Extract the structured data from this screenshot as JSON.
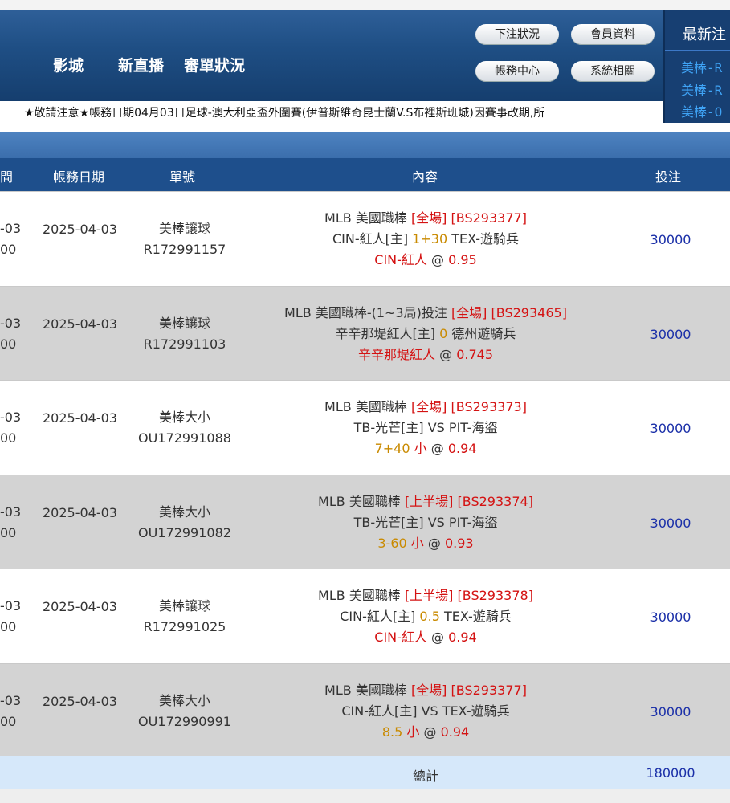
{
  "header": {
    "nav": [
      "影城",
      "新直播",
      "審單狀況"
    ],
    "buttons": [
      "下注狀況",
      "會員資料",
      "帳務中心",
      "系統相關"
    ],
    "news_title": "最新注",
    "news_items": [
      "美棒-R",
      "美棒-R",
      "美棒-O"
    ],
    "marquee": "★敬請注意★帳務日期04月03日足球-澳大利亞盃外圍賽(伊普斯維奇昆士蘭V.S布裡斯班城)因賽事改期,所"
  },
  "table": {
    "columns": [
      "間",
      "帳務日期",
      "單號",
      "內容",
      "投注"
    ],
    "rows": [
      {
        "time": [
          "-03",
          "00"
        ],
        "date": "2025-04-03",
        "ticket_type": "美棒讓球",
        "ticket_no": "R172991157",
        "league": "MLB 美國職棒",
        "period": "[全場]",
        "code": "[BS293377]",
        "home": "CIN-紅人[主]",
        "line": "1+30",
        "away": "TEX-遊騎兵",
        "pick": "CIN-紅人",
        "pick_extra": "",
        "odds": "0.95",
        "amount": "30000"
      },
      {
        "time": [
          "-03",
          "00"
        ],
        "date": "2025-04-03",
        "ticket_type": "美棒讓球",
        "ticket_no": "R172991103",
        "league": "MLB 美國職棒-(1~3局)投注",
        "period": "[全場]",
        "code": "[BS293465]",
        "home": "辛辛那堤紅人[主]",
        "line": "0",
        "away": "德州遊騎兵",
        "pick": "辛辛那堤紅人",
        "pick_extra": "",
        "odds": "0.745",
        "amount": "30000"
      },
      {
        "time": [
          "-03",
          "00"
        ],
        "date": "2025-04-03",
        "ticket_type": "美棒大小",
        "ticket_no": "OU172991088",
        "league": "MLB 美國職棒",
        "period": "[全場]",
        "code": "[BS293373]",
        "home": "TB-光芒[主]",
        "line": "VS",
        "away": "PIT-海盜",
        "pick": "小",
        "pick_extra": "7+40",
        "odds": "0.94",
        "amount": "30000"
      },
      {
        "time": [
          "-03",
          "00"
        ],
        "date": "2025-04-03",
        "ticket_type": "美棒大小",
        "ticket_no": "OU172991082",
        "league": "MLB 美國職棒",
        "period": "[上半場]",
        "code": "[BS293374]",
        "home": "TB-光芒[主]",
        "line": "VS",
        "away": "PIT-海盜",
        "pick": "小",
        "pick_extra": "3-60",
        "odds": "0.93",
        "amount": "30000"
      },
      {
        "time": [
          "-03",
          "00"
        ],
        "date": "2025-04-03",
        "ticket_type": "美棒讓球",
        "ticket_no": "R172991025",
        "league": "MLB 美國職棒",
        "period": "[上半場]",
        "code": "[BS293378]",
        "home": "CIN-紅人[主]",
        "line": "0.5",
        "away": "TEX-遊騎兵",
        "pick": "CIN-紅人",
        "pick_extra": "",
        "odds": "0.94",
        "amount": "30000"
      },
      {
        "time": [
          "-03",
          "00"
        ],
        "date": "2025-04-03",
        "ticket_type": "美棒大小",
        "ticket_no": "OU172990991",
        "league": "MLB 美國職棒",
        "period": "[全場]",
        "code": "[BS293377]",
        "home": "CIN-紅人[主]",
        "line": "VS",
        "away": "TEX-遊騎兵",
        "pick": "小",
        "pick_extra": "8.5",
        "odds": "0.94",
        "amount": "30000"
      }
    ],
    "total_label": "總計",
    "total_value": "180000"
  },
  "colors": {
    "header_bg": "#1f4f85",
    "table_header_bg": "#1e4f8c",
    "red_text": "#d41212",
    "gold_text": "#c98a00",
    "amount_text": "#1a2fa8",
    "totals_bg": "#d6e8fa"
  }
}
